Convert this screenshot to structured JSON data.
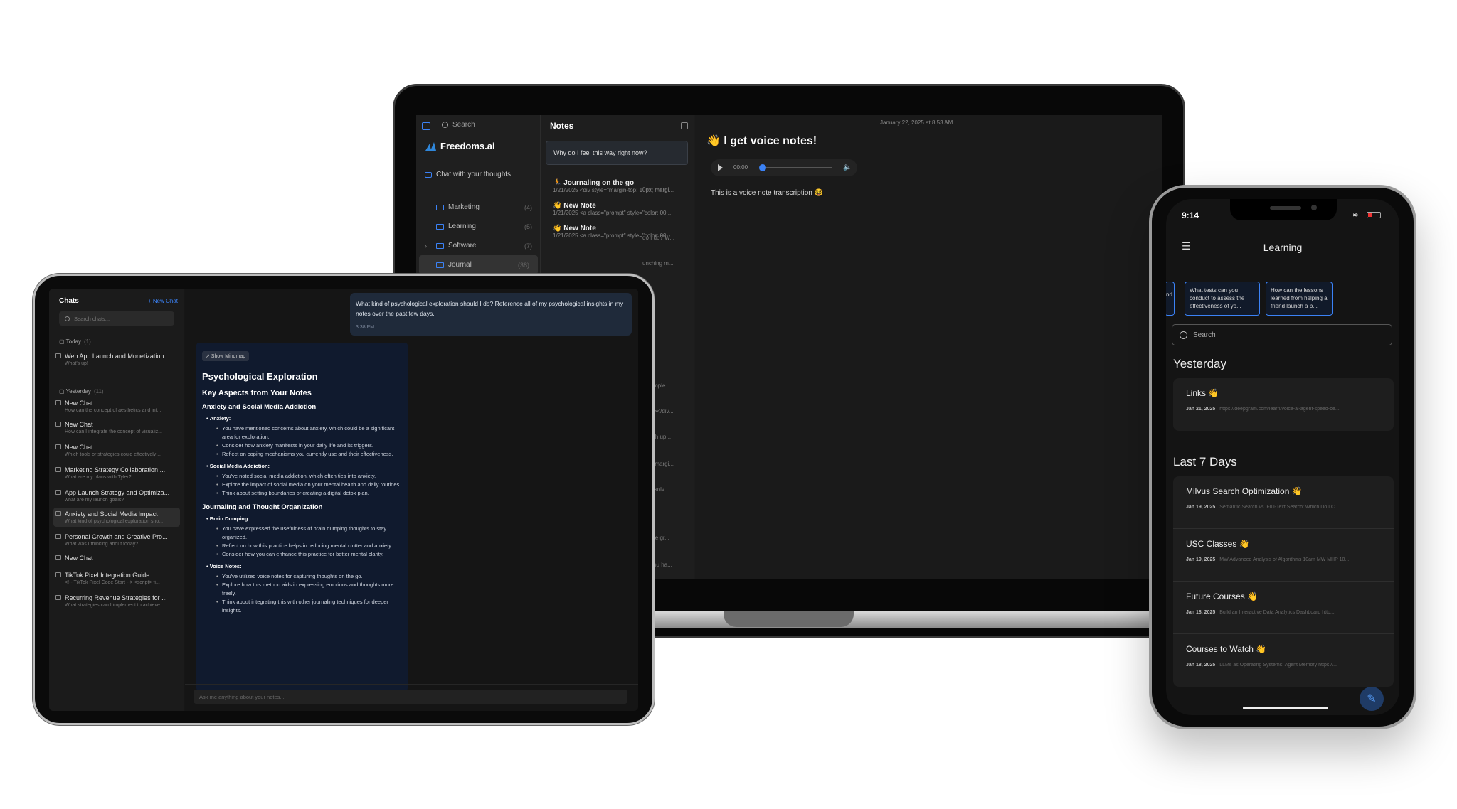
{
  "laptop": {
    "sidebar": {
      "search_placeholder": "Search",
      "brand": "Freedoms.ai",
      "chat_link": "Chat with your thoughts",
      "folders": [
        {
          "name": "Marketing",
          "count": "(4)"
        },
        {
          "name": "Learning",
          "count": "(5)"
        },
        {
          "name": "Software",
          "count": "(7)"
        },
        {
          "name": "Journal",
          "count": "(38)"
        }
      ]
    },
    "notes": {
      "title": "Notes",
      "search_card": "Why do I feel this way right now?",
      "items": [
        {
          "title": "🏃 Journaling on the go",
          "snippet": "1/21/2025 <div style=\"margin-top: 10px; margi..."
        },
        {
          "title": "👋 New Note",
          "snippet": "1/21/2025 <a class=\"prompt\" style=\"color: 00..."
        },
        {
          "title": "👋 New Note",
          "snippet": "1/21/2025 <a class=\"prompt\" style=\"color: 00..."
        }
      ],
      "fragments": [
        "0px; margi...",
        "do I do? W...",
        "unching m...",
        "a comple...",
        "v<br></div...",
        "nough up...",
        "0px; margi...",
        "e've solv...",
        "create gr...",
        "do you ha..."
      ]
    },
    "editor": {
      "timestamp": "January 22, 2025 at 8:53 AM",
      "title": "👋 I get voice notes!",
      "audio_time": "00:00",
      "body": "This is a voice note transcription 🤓"
    }
  },
  "tablet": {
    "sidebar": {
      "title": "Chats",
      "new_chat": "+ New Chat",
      "search_placeholder": "Search chats...",
      "group_today": "Today",
      "group_today_count": "(1)",
      "group_yesterday": "Yesterday",
      "group_yesterday_count": "(11)",
      "chats": [
        {
          "title": "Web App Launch and Monetization...",
          "sub": "What's up!"
        },
        {
          "title": "New Chat",
          "sub": "How can the concept of aesthetics and int..."
        },
        {
          "title": "New Chat",
          "sub": "How can I integrate the concept of visualiz..."
        },
        {
          "title": "New Chat",
          "sub": "Which tools or strategies could effectively ..."
        },
        {
          "title": "Marketing Strategy Collaboration ...",
          "sub": "What are my plans with Tyler?"
        },
        {
          "title": "App Launch Strategy and Optimiza...",
          "sub": "what are my launch goals?"
        },
        {
          "title": "Anxiety and Social Media Impact",
          "sub": "What kind of psychological exploration sho..."
        },
        {
          "title": "Personal Growth and Creative Pro...",
          "sub": "What was I thinking about today?"
        },
        {
          "title": "New Chat",
          "sub": ""
        },
        {
          "title": "TikTok Pixel Integration Guide",
          "sub": "<!-- TikTok Pixel Code Start --> <script> fi..."
        },
        {
          "title": "Recurring Revenue Strategies for ...",
          "sub": "What strategies can I implement to achieve..."
        }
      ]
    },
    "chat": {
      "user_message": "What kind of psychological exploration should I do? Reference all of my psychological insights in my notes over the past few days.",
      "user_time": "3:38 PM",
      "mindmap_button": "↗ Show Mindmap",
      "h1": "Psychological Exploration",
      "h2": "Key Aspects from Your Notes",
      "sections": [
        {
          "heading": "Anxiety and Social Media Addiction",
          "blocks": [
            {
              "label": "Anxiety:",
              "items": [
                "You have mentioned concerns about anxiety, which could be a significant area for exploration.",
                "Consider how anxiety manifests in your daily life and its triggers.",
                "Reflect on coping mechanisms you currently use and their effectiveness."
              ]
            },
            {
              "label": "Social Media Addiction:",
              "items": [
                "You've noted social media addiction, which often ties into anxiety.",
                "Explore the impact of social media on your mental health and daily routines.",
                "Think about setting boundaries or creating a digital detox plan."
              ]
            }
          ]
        },
        {
          "heading": "Journaling and Thought Organization",
          "blocks": [
            {
              "label": "Brain Dumping:",
              "items": [
                "You have expressed the usefulness of brain dumping thoughts to stay organized.",
                "Reflect on how this practice helps in reducing mental clutter and anxiety.",
                "Consider how you can enhance this practice for better mental clarity."
              ]
            },
            {
              "label": "Voice Notes:",
              "items": [
                "You've utilized voice notes for capturing thoughts on the go.",
                "Explore how this method aids in expressing emotions and thoughts more freely.",
                "Think about integrating this with other journaling techniques for deeper insights."
              ]
            }
          ]
        }
      ],
      "input_placeholder": "Ask me anything about your notes..."
    }
  },
  "phone": {
    "time": "9:14",
    "title": "Learning",
    "chips": [
      "nd",
      "What tests can you conduct to assess the effectiveness of yo...",
      "How can the lessons learned from helping a friend launch a b..."
    ],
    "search_placeholder": "Search",
    "section_yesterday": "Yesterday",
    "section_last7": "Last 7 Days",
    "yesterday_notes": [
      {
        "title": "Links 👋",
        "date": "Jan 21, 2025",
        "snippet": "https://deepgram.com/learn/voice-ai-agent-speed-be..."
      }
    ],
    "week_notes": [
      {
        "title": "Milvus Search Optimization 👋",
        "date": "Jan 19, 2025",
        "snippet": "Semantic Search vs. Full-Text Search: Which Do I C..."
      },
      {
        "title": "USC Classes 👋",
        "date": "Jan 19, 2025",
        "snippet": "MW Advanced Analysis of Algorithms 10am MW MHP 10..."
      },
      {
        "title": "Future Courses 👋",
        "date": "Jan 18, 2025",
        "snippet": "Build an Interactive Data Analytics Dashboard http..."
      },
      {
        "title": "Courses to Watch 👋",
        "date": "Jan 18, 2025",
        "snippet": "LLMs as Operating Systems: Agent Memory https://..."
      }
    ]
  }
}
